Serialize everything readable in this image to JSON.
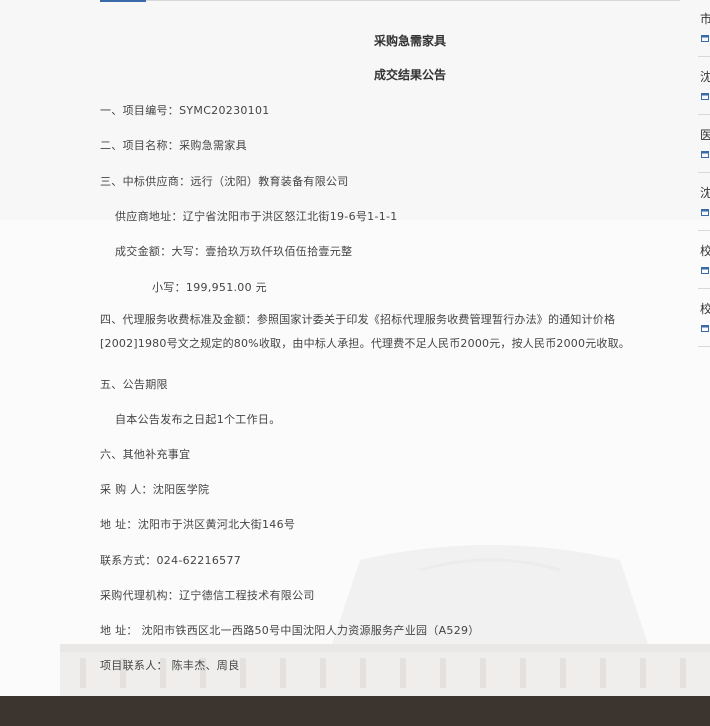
{
  "article": {
    "title": "采购急需家具",
    "subtitle": "成交结果公告",
    "item1": "一、项目编号：SYMC20230101",
    "item2": "二、项目名称：采购急需家具",
    "item3": "三、中标供应商：远行（沈阳）教育装备有限公司",
    "supplier_address": "供应商地址：辽宁省沈阳市于洪区怒江北街19-6号1-1-1",
    "amount_upper": "成交金额：大写：壹拾玖万玖仟玖佰伍拾壹元整",
    "amount_lower": "小写：199,951.00 元",
    "item4_line1": "四、代理服务收费标准及金额：参照国家计委关于印发《招标代理服务收费管理暂行办法》的通知计价格",
    "item4_line2": "[2002]1980号文之规定的80%收取，由中标人承担。代理费不足人民币2000元，按人民币2000元收取。",
    "item5": "五、公告期限",
    "item5_text": "自本公告发布之日起1个工作日。",
    "item6": "六、其他补充事宜",
    "purchaser": "采  购  人：沈阳医学院",
    "purchaser_address": "地      址：沈阳市于洪区黄河北大街146号",
    "contact": "联系方式：024-62216577",
    "agency": "采购代理机构：辽宁德信工程技术有限公司",
    "agency_address": "地      址：  沈阳市铁西区北一西路50号中国沈阳人力资源服务产业园（A529）",
    "project_contact": "项目联系人：  陈丰杰、周良"
  },
  "sidebar": {
    "items": [
      {
        "label": "市",
        "icon": "calendar-icon"
      },
      {
        "label": "沈",
        "icon": "calendar-icon"
      },
      {
        "label": "医",
        "icon": "calendar-icon"
      },
      {
        "label": "沈",
        "icon": "calendar-icon"
      },
      {
        "label": "校",
        "icon": "calendar-icon"
      },
      {
        "label": "校",
        "icon": "calendar-icon"
      }
    ]
  },
  "colors": {
    "accent": "#3a6aa8",
    "footer": "#3b342f",
    "text": "#444444"
  }
}
